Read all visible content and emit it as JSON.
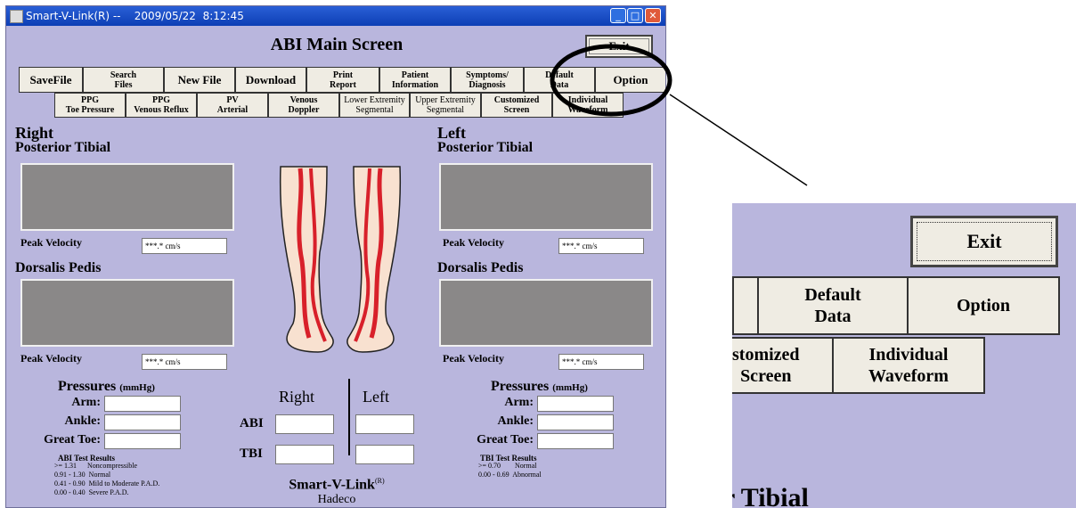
{
  "window": {
    "title": "Smart-V-Link(R) --    2009/05/22  8:12:45",
    "screen_title": "ABI Main Screen",
    "exit_label": "Exit",
    "colors": {
      "background": "#b9b6dd",
      "titlebar": "#1a4fc8",
      "button": "#efece3",
      "waveform": "#8a8888"
    }
  },
  "toolbar_row1": [
    "SaveFile",
    "Search\nFiles",
    "New File",
    "Download",
    "Print\nReport",
    "Patient\nInformation",
    "Symptoms/\nDiagnosis",
    "Default\nData",
    "Option"
  ],
  "toolbar_row2": [
    "PPG\nToe Pressure",
    "PPG\nVenous Reflux",
    "PV\nArterial",
    "Venous\nDoppler",
    "Lower Extremity\nSegmental",
    "Upper Extremity\nSegmental",
    "Customized\nScreen",
    "Individual\nWaveform"
  ],
  "right": {
    "side": "Right",
    "posterior_tibial": "Posterior Tibial",
    "dorsalis_pedis": "Dorsalis Pedis",
    "peak_velocity_label": "Peak Velocity",
    "pt_peak_velocity": "***.* cm/s",
    "dp_peak_velocity": "***.* cm/s"
  },
  "left": {
    "side": "Left",
    "posterior_tibial": "Posterior Tibial",
    "dorsalis_pedis": "Dorsalis Pedis",
    "peak_velocity_label": "Peak Velocity",
    "pt_peak_velocity": "***.* cm/s",
    "dp_peak_velocity": "***.* cm/s"
  },
  "pressures": {
    "title": "Pressures",
    "unit": "(mmHg)",
    "arm": "Arm:",
    "ankle": "Ankle:",
    "great_toe": "Great Toe:"
  },
  "indices": {
    "right_header": "Right",
    "left_header": "Left",
    "abi": "ABI",
    "tbi": "TBI"
  },
  "abi_results": {
    "title": "ABI Test Results",
    "lines": [
      ">= 1.31      Noncompressible",
      "0.91 - 1.30  Normal",
      "0.41 - 0.90  Mild to Moderate P.A.D.",
      "0.00 - 0.40  Severe P.A.D."
    ]
  },
  "tbi_results": {
    "title": "TBI Test Results",
    "lines": [
      ">= 0.70        Normal",
      "0.00 - 0.69  Abnormal"
    ]
  },
  "brand": {
    "name": "Smart-V-Link",
    "reg": "(R)",
    "company": "Hadeco"
  },
  "zoom": {
    "exit": "Exit",
    "default_data": "Default\nData",
    "option": "Option",
    "customized_fragment": "stomized\nScreen",
    "individual_waveform": "Individual\nWaveform",
    "tibial_fragment": "r Tibial"
  }
}
